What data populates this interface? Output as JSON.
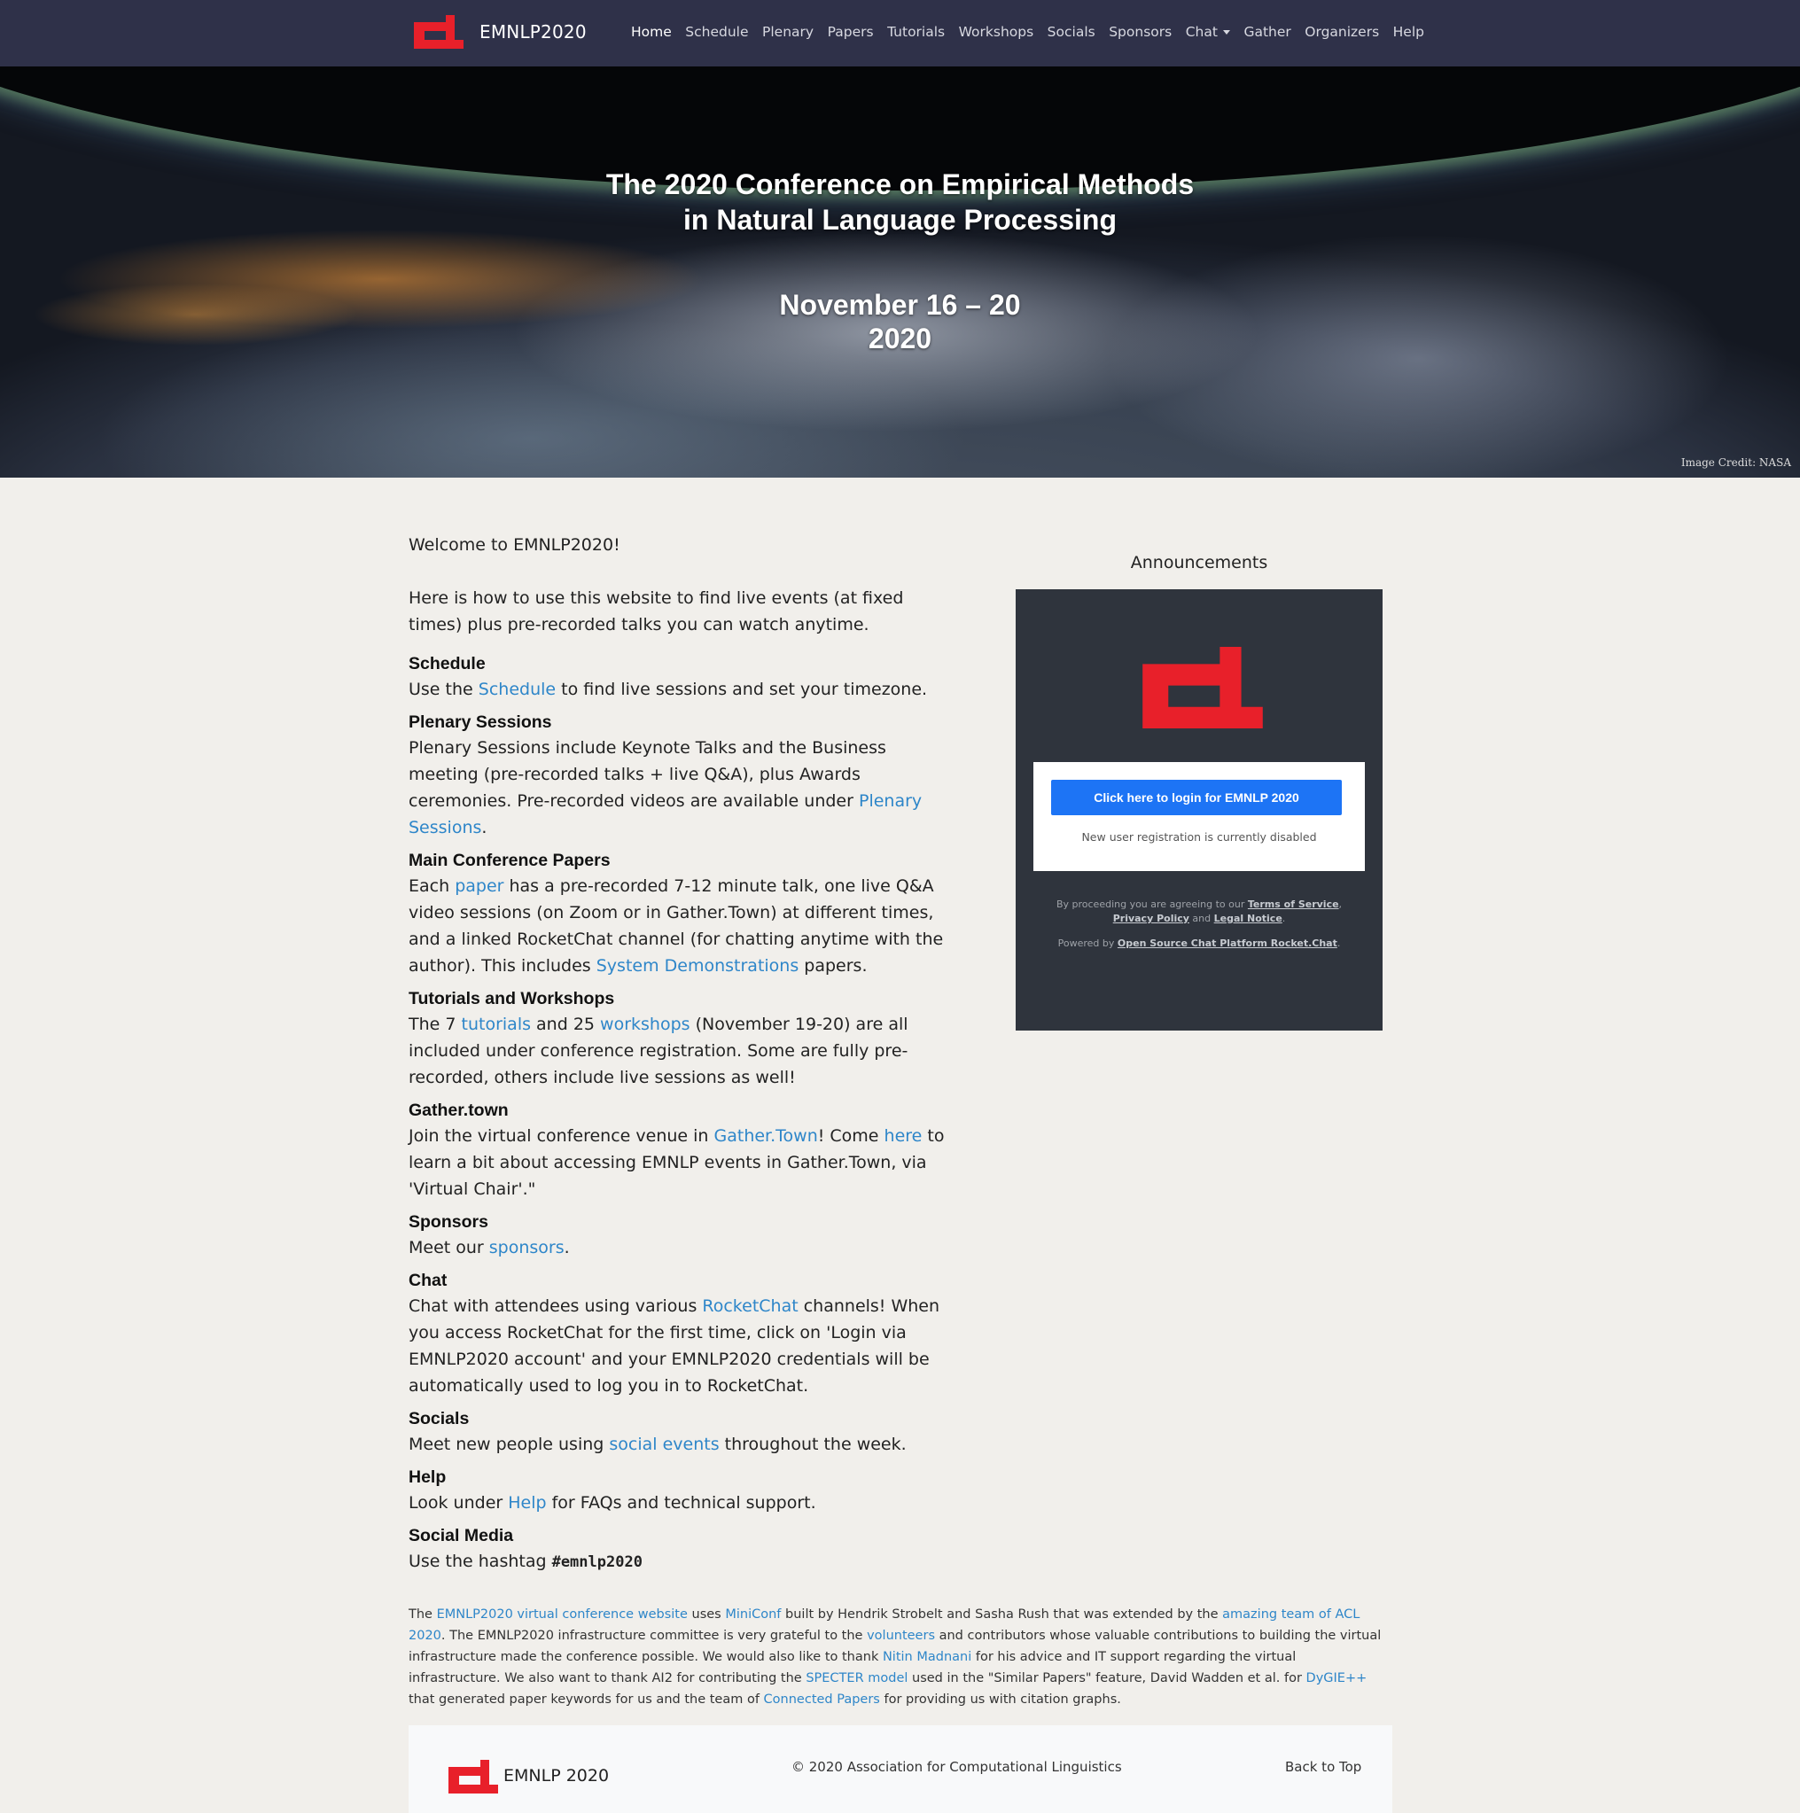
{
  "nav": {
    "brand": "EMNLP2020",
    "items": [
      "Home",
      "Schedule",
      "Plenary",
      "Papers",
      "Tutorials",
      "Workshops",
      "Socials",
      "Sponsors",
      "Chat",
      "Gather",
      "Organizers",
      "Help"
    ],
    "active": "Home"
  },
  "hero": {
    "title_line1": "The 2020 Conference on Empirical Methods",
    "title_line2": "in Natural Language Processing",
    "date_line1": "November 16 – 20",
    "date_line2": "2020",
    "credit": "Image Credit: NASA"
  },
  "main": {
    "welcome": "Welcome to EMNLP2020!",
    "intro": "Here is how to use this website to find live events (at fixed times) plus pre-recorded talks you can watch anytime.",
    "schedule": {
      "title": "Schedule",
      "t1": "Use the ",
      "link": "Schedule",
      "t2": " to find live sessions and set your timezone."
    },
    "plenary": {
      "title": "Plenary Sessions",
      "t1": "Plenary Sessions include Keynote Talks and the Business meeting (pre-recorded talks + live Q&A), plus Awards ceremonies. Pre-recorded videos are available under ",
      "link": "Plenary Sessions",
      "t2": "."
    },
    "papers": {
      "title": "Main Conference Papers",
      "t1": "Each ",
      "link1": "paper",
      "t2": " has a pre-recorded 7-12 minute talk, one live Q&A video sessions (on Zoom or in Gather.Town) at different times, and a linked RocketChat channel (for chatting anytime with the author). This includes ",
      "link2": "System Demonstrations",
      "t3": " papers."
    },
    "tutorials": {
      "title": "Tutorials and Workshops",
      "t1": "The 7 ",
      "link1": "tutorials",
      "t2": " and 25 ",
      "link2": "workshops",
      "t3": " (November 19-20) are all included under conference registration. Some are fully pre-recorded, others include live sessions as well!"
    },
    "gather": {
      "title": "Gather.town",
      "t1": "Join the virtual conference venue in ",
      "link1": "Gather.Town",
      "t2": "! Come ",
      "link2": "here",
      "t3": " to learn a bit about accessing EMNLP events in Gather.Town, via 'Virtual Chair'.\""
    },
    "sponsors": {
      "title": "Sponsors",
      "t1": "Meet our ",
      "link": "sponsors",
      "t2": "."
    },
    "chat": {
      "title": "Chat",
      "t1": "Chat with attendees using various ",
      "link": "RocketChat",
      "t2": " channels! When you access RocketChat for the first time, click on 'Login via EMNLP2020 account' and your EMNLP2020 credentials will be automatically used to log you in to RocketChat."
    },
    "socials": {
      "title": "Socials",
      "t1": "Meet new people using ",
      "link": "social events",
      "t2": " throughout the week."
    },
    "help": {
      "title": "Help",
      "t1": "Look under ",
      "link": "Help",
      "t2": " for FAQs and technical support."
    },
    "social_media": {
      "title": "Social Media",
      "t1": "Use the hashtag ",
      "hashtag": "#emnlp2020"
    }
  },
  "announcements": {
    "title": "Announcements",
    "login_button": "Click here to login for EMNLP 2020",
    "registration_note": "New user registration is currently disabled",
    "legal_prefix": "By proceeding you are agreeing to our ",
    "terms": "Terms of Service",
    "comma": ", ",
    "privacy": "Privacy Policy",
    "and": " and ",
    "legal_notice": "Legal Notice",
    "period": ".",
    "powered_prefix": "Powered by ",
    "powered_link": "Open Source Chat Platform Rocket.Chat",
    "bg_color": "#2f343d",
    "button_color": "#1d74f5"
  },
  "credits": {
    "t1": "The ",
    "l1": "EMNLP2020 virtual conference website",
    "t2": " uses ",
    "l2": "MiniConf",
    "t3": " built by Hendrik Strobelt and Sasha Rush that was extended by the ",
    "l3": "amazing team of ACL 2020",
    "t4": ". The EMNLP2020 infrastructure committee is very grateful to the ",
    "l4": "volunteers",
    "t5": " and contributors whose valuable contributions to building the virtual infrastructure made the conference possible. We would also like to thank ",
    "l5": "Nitin Madnani",
    "t6": " for his advice and IT support regarding the virtual infrastructure. We also want to thank AI2 for contributing the ",
    "l6": "SPECTER model",
    "t7": " used in the \"Similar Papers\" feature, David Wadden et al. for ",
    "l7": "DyGIE++",
    "t8": " that generated paper keywords for us and the team of ",
    "l8": "Connected Papers",
    "t9": " for providing us with citation graphs."
  },
  "footer": {
    "brand": "EMNLP 2020",
    "copyright": "© 2020 Association for Computational Linguistics",
    "back_to_top": "Back to Top"
  },
  "colors": {
    "navbar": "#2f3149",
    "logo_red": "#e8202a",
    "link": "#2e86c9",
    "page_bg": "#f1efeb"
  }
}
